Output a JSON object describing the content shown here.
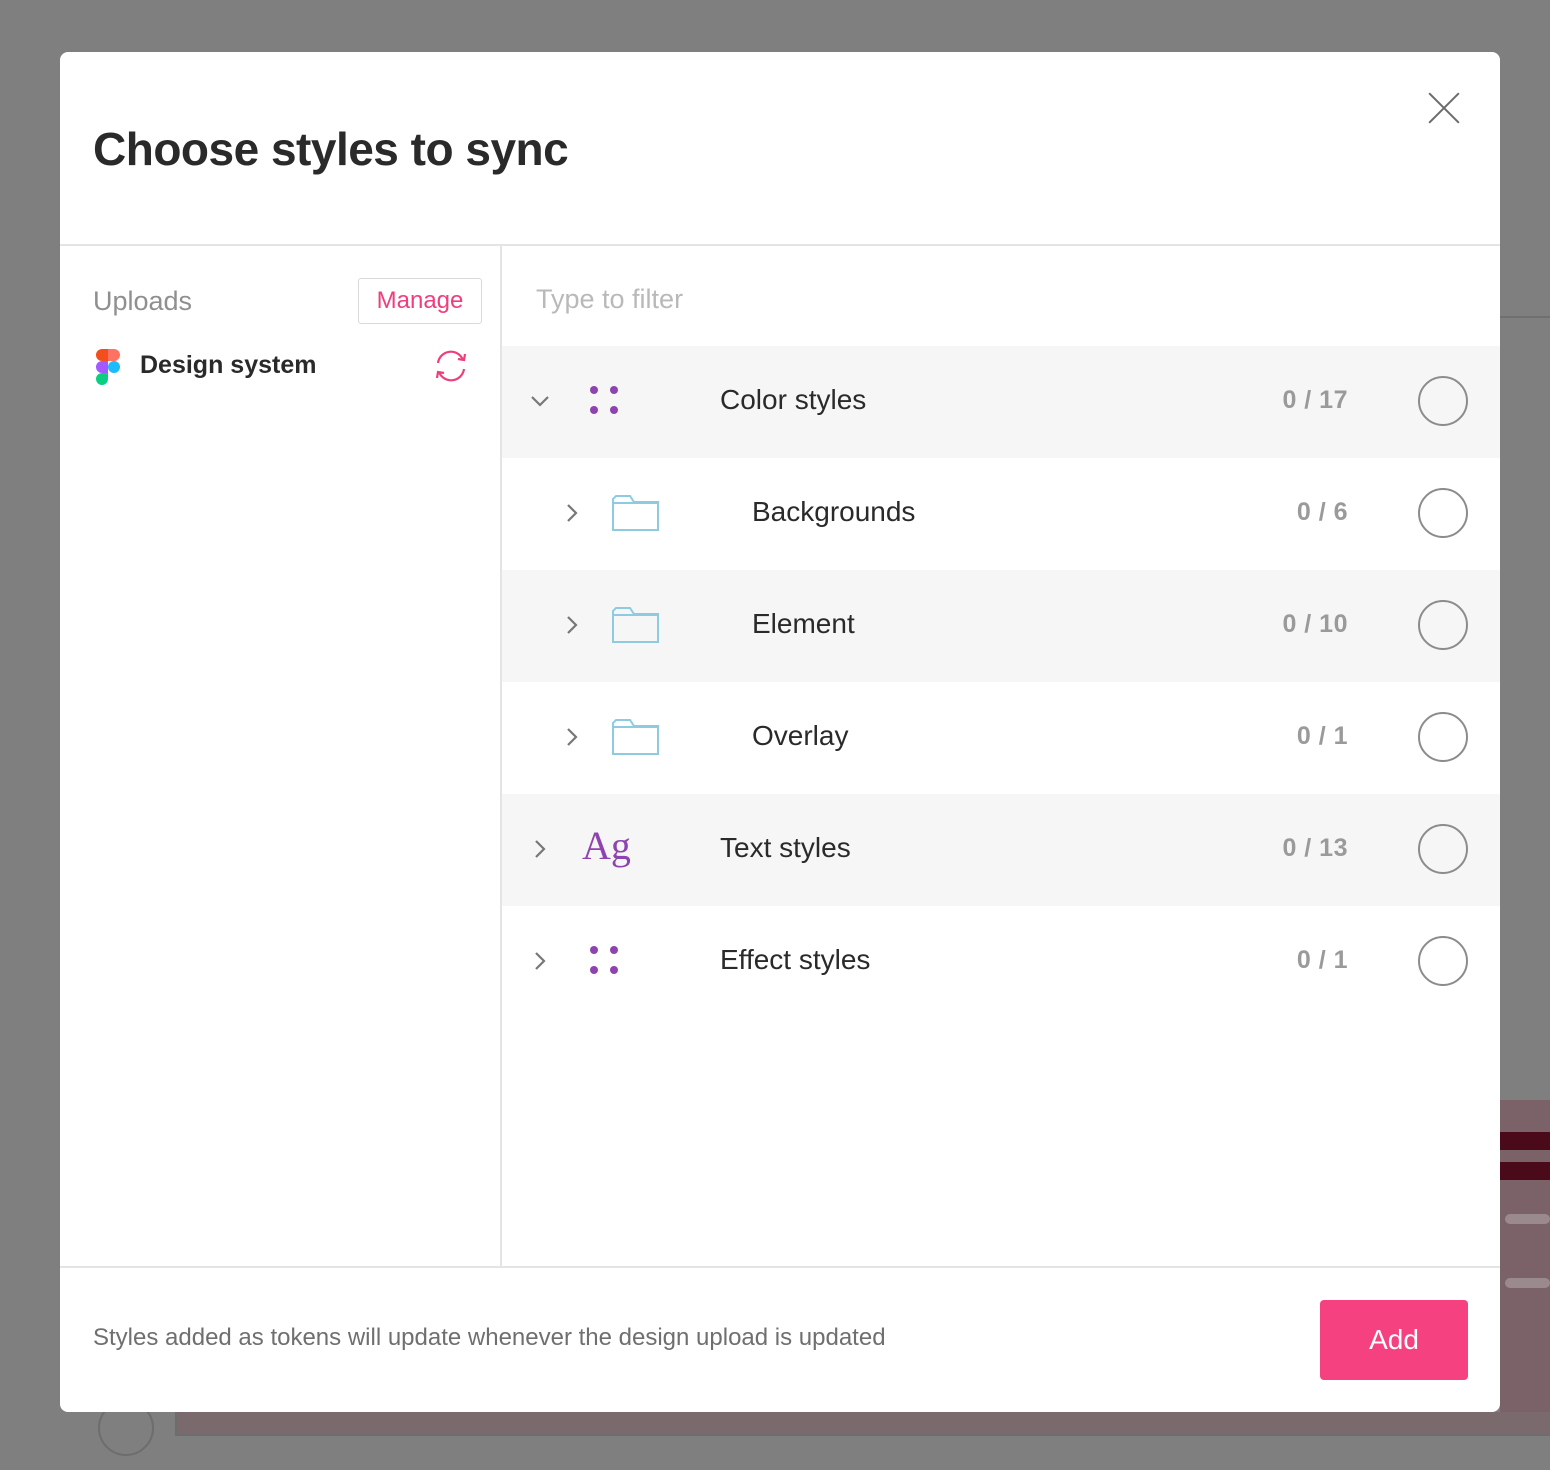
{
  "dialog": {
    "title": "Choose styles to sync",
    "close_icon": "close-icon"
  },
  "sidebar": {
    "uploads_label": "Uploads",
    "manage_label": "Manage",
    "upload": {
      "name": "Design system",
      "icon": "figma-logo-icon",
      "action_icon": "sync-icon"
    }
  },
  "filter": {
    "placeholder": "Type to filter",
    "value": ""
  },
  "tree": {
    "items": [
      {
        "label": "Color styles",
        "count": "0 / 17",
        "expanded": true,
        "icon": "color-dots-icon",
        "level": 0
      },
      {
        "label": "Backgrounds",
        "count": "0 / 6",
        "expanded": false,
        "icon": "folder-icon",
        "level": 1
      },
      {
        "label": "Element",
        "count": "0 / 10",
        "expanded": false,
        "icon": "folder-icon",
        "level": 1
      },
      {
        "label": "Overlay",
        "count": "0 / 1",
        "expanded": false,
        "icon": "folder-icon",
        "level": 1
      },
      {
        "label": "Text styles",
        "count": "0 / 13",
        "expanded": false,
        "icon": "text-ag-icon",
        "icon_text": "Ag",
        "level": 0
      },
      {
        "label": "Effect styles",
        "count": "0 / 1",
        "expanded": false,
        "icon": "effect-dots-icon",
        "level": 0
      }
    ]
  },
  "footer": {
    "note": "Styles added as tokens will update whenever the design upload is updated",
    "add_label": "Add"
  },
  "colors": {
    "accent": "#f5417f",
    "purple_icon": "#8e44b0",
    "folder_icon": "#8fcbe0"
  }
}
